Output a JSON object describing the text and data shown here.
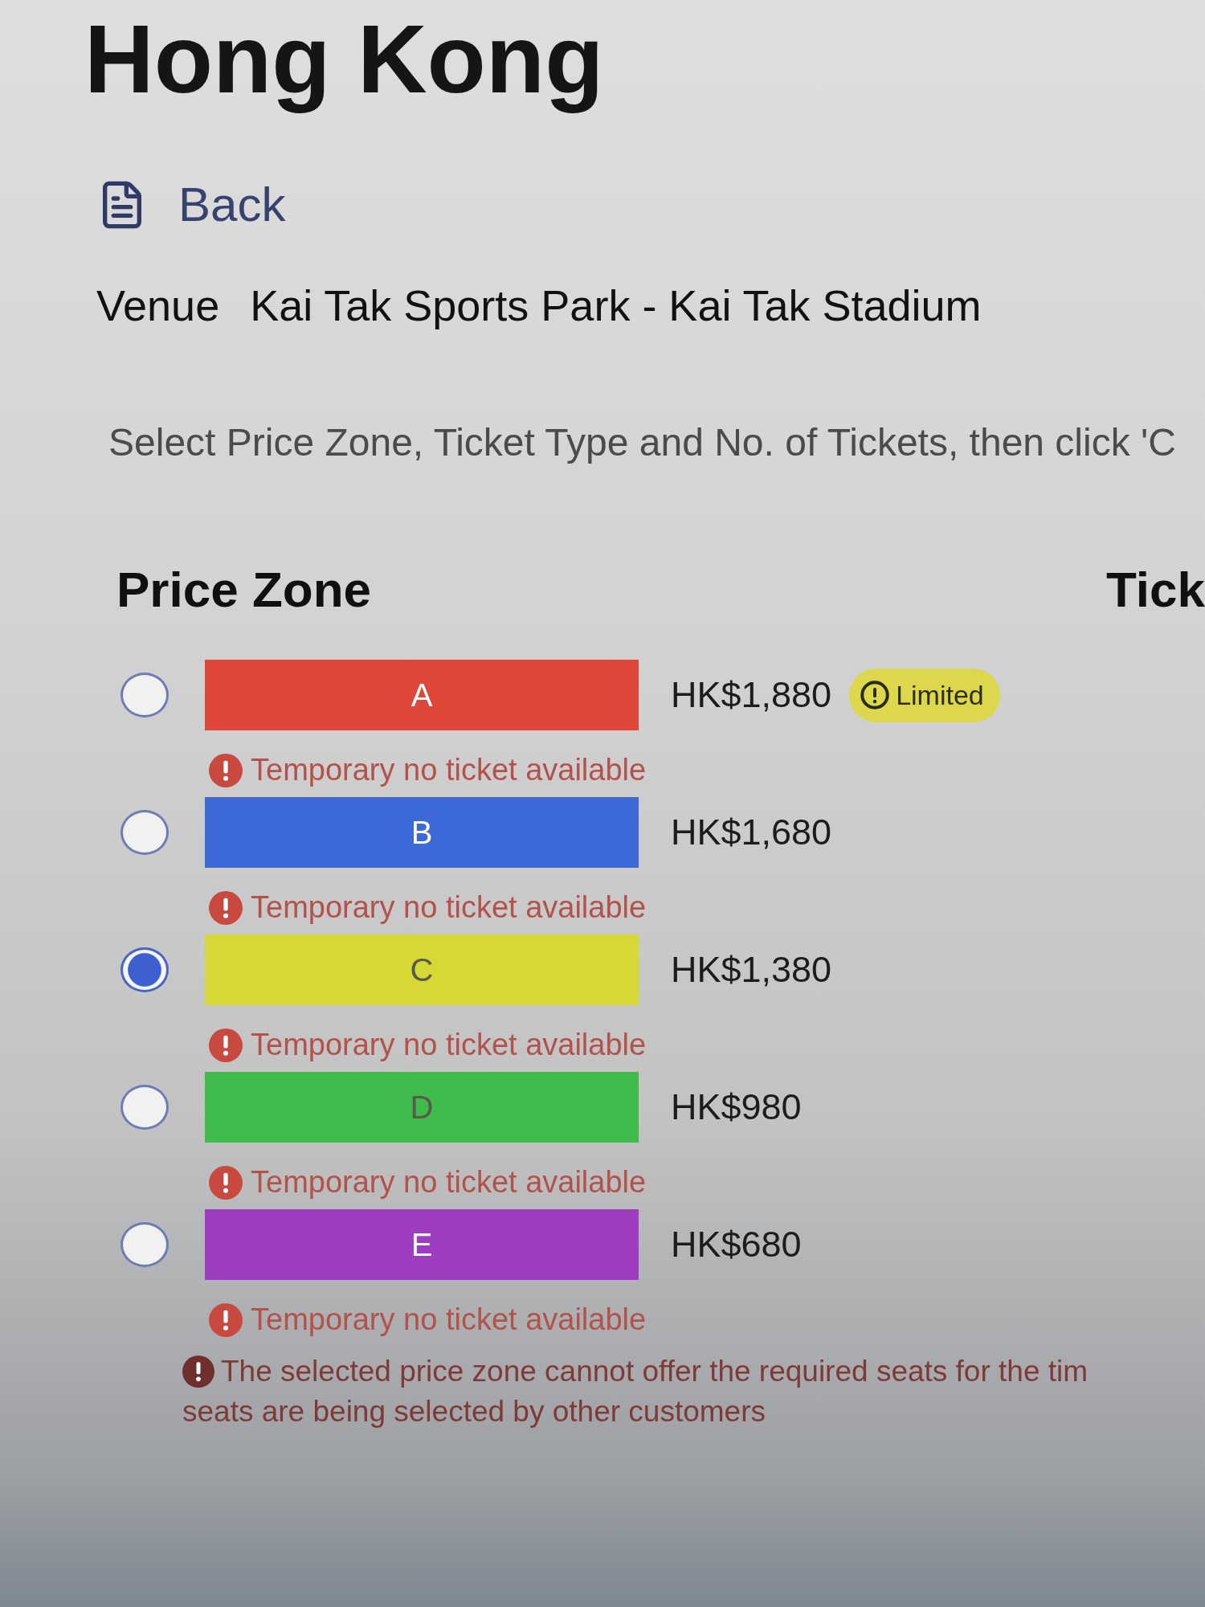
{
  "page": {
    "title": "Hong Kong"
  },
  "back_link": {
    "label": "Back"
  },
  "venue": {
    "label": "Venue",
    "value": "Kai Tak Sports Park - Kai Tak Stadium"
  },
  "instructions": "Select Price Zone, Ticket Type and No. of Tickets, then click 'C",
  "price_zone": {
    "heading": "Price Zone",
    "zones": [
      {
        "name": "A",
        "color": "#e0473b",
        "price": "HK$1,880",
        "badge": "Limited",
        "notice": "Temporary no ticket available",
        "selected": false
      },
      {
        "name": "B",
        "color": "#3d69d8",
        "price": "HK$1,680",
        "notice": "Temporary no ticket available",
        "selected": false
      },
      {
        "name": "C",
        "color": "#d6d835",
        "price": "HK$1,380",
        "notice": "Temporary no ticket available",
        "selected": true
      },
      {
        "name": "D",
        "color": "#3fbb4c",
        "price": "HK$980",
        "notice": "Temporary no ticket available",
        "selected": false
      },
      {
        "name": "E",
        "color": "#9e3dbf",
        "price": "HK$680",
        "notice": "Temporary no ticket available",
        "selected": false
      }
    ]
  },
  "ticket_type": {
    "heading": "Tick"
  },
  "error": {
    "lines": [
      "The selected price zone cannot offer the required seats for the tim",
      "seats are being selected by other customers"
    ]
  }
}
